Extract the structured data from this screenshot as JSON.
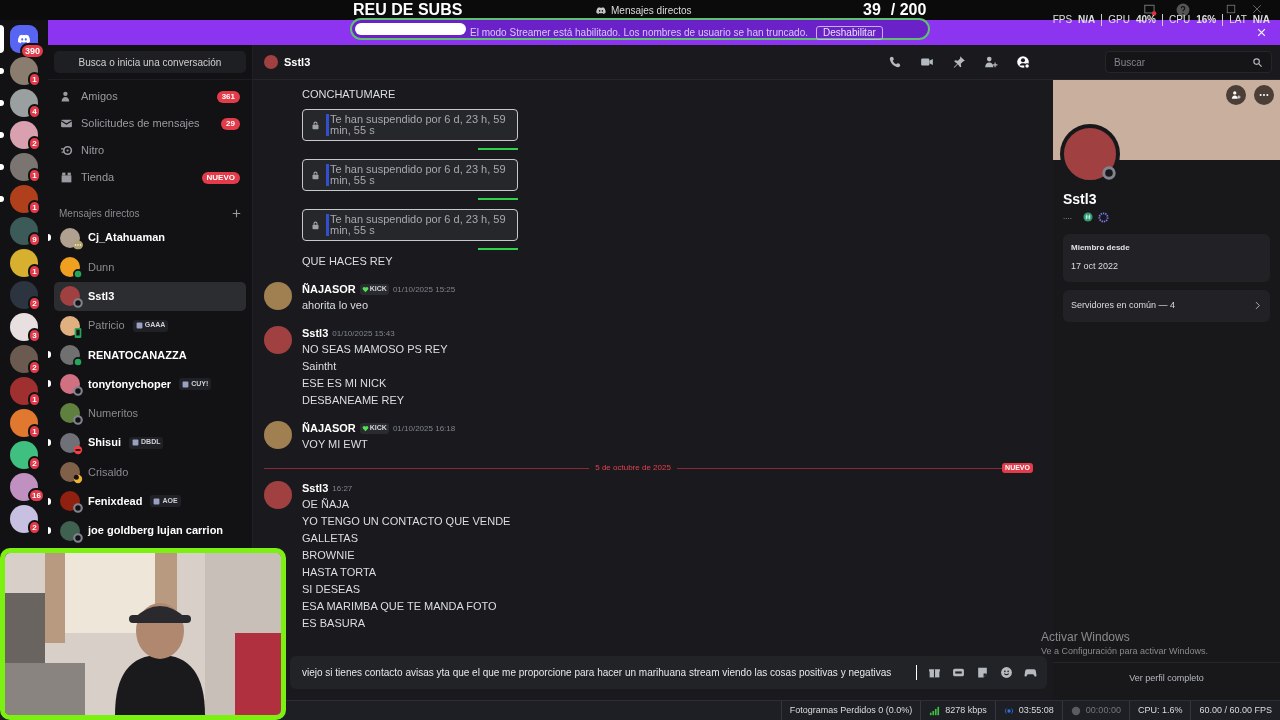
{
  "stream_overlay": {
    "title": "REU DE SUBS",
    "goal": {
      "count": "39",
      "total": "/ 200",
      "level": 0.195
    },
    "stats": [
      {
        "label": "FPS",
        "value": "N/A"
      },
      {
        "label": "GPU",
        "value": "40%"
      },
      {
        "label": "CPU",
        "value": "16%"
      },
      {
        "label": "LAT",
        "value": "N/A"
      }
    ]
  },
  "window": {
    "title": "Mensajes directos"
  },
  "banner": {
    "text": "El modo Streamer está habilitado. Los nombres de usuario se han truncado.",
    "button": "Deshabilitar"
  },
  "server_rail": {
    "home_badge": "390",
    "servers": [
      {
        "badge": "1",
        "unread": true,
        "color": "#8a7d70"
      },
      {
        "badge": "4",
        "unread": true,
        "color": "#9aa0a0"
      },
      {
        "badge": "2",
        "unread": true,
        "color": "#d9a0b0"
      },
      {
        "badge": "1",
        "unread": true,
        "color": "#7a7570"
      },
      {
        "badge": "1",
        "unread": true,
        "color": "#b0401c"
      },
      {
        "badge": "9",
        "unread": false,
        "color": "#3c5a58"
      },
      {
        "badge": "1",
        "unread": false,
        "color": "#d8b030"
      },
      {
        "badge": "2",
        "unread": false,
        "color": "#2c3440"
      },
      {
        "badge": "3",
        "unread": false,
        "color": "#e8e0e0"
      },
      {
        "badge": "2",
        "unread": false,
        "color": "#6a5a50"
      },
      {
        "badge": "1",
        "unread": false,
        "color": "#a03030"
      },
      {
        "badge": "1",
        "unread": false,
        "color": "#e07830"
      },
      {
        "badge": "2",
        "unread": false,
        "color": "#40c080"
      },
      {
        "badge": "16",
        "unread": false,
        "color": "#c090c0"
      },
      {
        "badge": "2",
        "unread": false,
        "color": "#c8c0e0"
      }
    ]
  },
  "sidebar": {
    "search": "Busca o inicia una conversación",
    "nav": [
      {
        "kind": "friends",
        "label": "Amigos",
        "badge": "361"
      },
      {
        "kind": "requests",
        "label": "Solicitudes de mensajes",
        "badge": "29"
      },
      {
        "kind": "nitro",
        "label": "Nitro"
      },
      {
        "kind": "shop",
        "label": "Tienda",
        "badge": "NUEVO"
      }
    ],
    "dm_header": "Mensajes directos",
    "dms": [
      {
        "name": "Cj_Atahuaman",
        "kind": "typing",
        "unread": true,
        "selected": false,
        "color": "#b0a090"
      },
      {
        "name": "Dunn",
        "kind": "online",
        "unread": false,
        "selected": false,
        "color": "#f0a020"
      },
      {
        "name": "Sstl3",
        "kind": "offline",
        "unread": false,
        "selected": true,
        "color": "#a04040"
      },
      {
        "name": "Patricio",
        "tag": "GAAA",
        "kind": "mobile",
        "unread": false,
        "selected": false,
        "color": "#e0b080"
      },
      {
        "name": "RENATOCANAZZA",
        "kind": "online",
        "unread": true,
        "selected": false,
        "color": "#707070"
      },
      {
        "name": "tonytonychoper",
        "tag": "CUY!",
        "kind": "offline",
        "unread": true,
        "selected": false,
        "color": "#d07080"
      },
      {
        "name": "Numeritos",
        "kind": "offline",
        "unread": false,
        "selected": false,
        "color": "#608040"
      },
      {
        "name": "Shisui",
        "tag": "DBDL",
        "kind": "dnd",
        "unread": true,
        "selected": false,
        "color": "#707078"
      },
      {
        "name": "Crisaldo",
        "kind": "idle",
        "unread": false,
        "selected": false,
        "color": "#806048"
      },
      {
        "name": "Fenixdead",
        "tag": "AOE",
        "kind": "offline",
        "unread": true,
        "selected": false,
        "color": "#902010"
      },
      {
        "name": "joe goldberg lujan carrion",
        "kind": "offline",
        "unread": true,
        "selected": false,
        "color": "#406050"
      }
    ]
  },
  "chat": {
    "header": {
      "name": "Sstl3",
      "search_placeholder": "Buscar"
    },
    "messages": [
      {
        "kind": "line",
        "text": "CONCHATUMARE"
      },
      {
        "kind": "notice",
        "text": "Te han suspendido por 6 d, 23 h, 59 min, 55 s"
      },
      {
        "kind": "notice",
        "text": "Te han suspendido por 6 d, 23 h, 59 min, 55 s"
      },
      {
        "kind": "notice",
        "text": "Te han suspendido por 6 d, 23 h, 59 min, 55 s"
      },
      {
        "kind": "line",
        "text": "QUE HACES REY"
      },
      {
        "kind": "group",
        "author": "ÑAJASOR",
        "tag": "KICK",
        "time": "01/10/2025 15:25",
        "color": "#a08050",
        "lines": [
          "ahorita lo veo"
        ]
      },
      {
        "kind": "group",
        "author": "Sstl3",
        "time": "01/10/2025 15:43",
        "color": "#a04040",
        "lines": [
          "NO SEAS MAMOSO PS REY",
          "Saintht",
          "ESE ES MI NICK",
          "DESBANEAME REY"
        ]
      },
      {
        "kind": "group",
        "author": "ÑAJASOR",
        "tag": "KICK",
        "time": "01/10/2025 16:18",
        "color": "#a08050",
        "lines": [
          "VOY MI EWT"
        ]
      },
      {
        "kind": "divider",
        "date": "5 de octubre de 2025",
        "badge": "NUEVO"
      },
      {
        "kind": "group",
        "author": "Sstl3",
        "time": "16:27",
        "color": "#a04040",
        "lines": [
          "OE ÑAJA",
          "YO TENGO UN CONTACTO QUE VENDE",
          "GALLETAS",
          "BROWNIE",
          "HASTA TORTA",
          "SI DESEAS",
          "ESA MARIMBA QUE TE MANDA FOTO",
          "ES BASURA"
        ]
      }
    ],
    "composer": {
      "value": "viejo si tienes contacto avisas yta que el que me proporcione para hacer un marihuana stream viendo las cosas positivas y negativas"
    }
  },
  "profile": {
    "name": "Sstl3",
    "subtitle": "....",
    "member_label": "Miembro desde",
    "member_since": "17 oct 2022",
    "mutual": "Servidores en común — 4",
    "full_profile": "Ver perfil completo"
  },
  "windows_notice": {
    "title": "Activar Windows",
    "text": "Ve a Configuración para activar Windows."
  },
  "status_bar": {
    "dropped": "Fotogramas Perdidos 0 (0.0%)",
    "bitrate": "8278 kbps",
    "stream_time": "03:55:08",
    "record_time": "00:00:00",
    "cpu": "CPU: 1.6%",
    "fps": "60.00 / 60.00 FPS"
  }
}
